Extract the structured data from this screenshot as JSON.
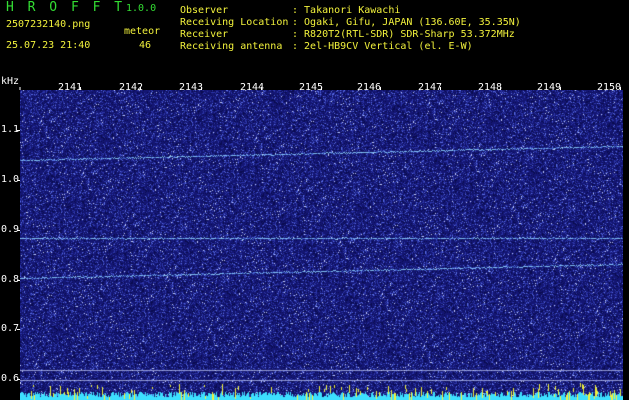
{
  "header": {
    "app_title": "H R O F F T",
    "version": "1.0.0",
    "file_name": "2507232140.png",
    "meteor_label": "meteor",
    "date_time": "25.07.23 21:40",
    "meteor_count": "46",
    "info": [
      {
        "key": "Observer",
        "value": ": Takanori Kawachi"
      },
      {
        "key": "Receiving Location",
        "value": ": Ogaki, Gifu, JAPAN (136.60E, 35.35N)"
      },
      {
        "key": "Receiver",
        "value": ": R820T2(RTL-SDR) SDR-Sharp 53.372MHz"
      },
      {
        "key": "Receiving antenna",
        "value": ": 2el-HB9CV Vertical (el. E-W)"
      }
    ]
  },
  "axes": {
    "y_unit": "kHz",
    "x_ticks": [
      "2141",
      "2142",
      "2143",
      "2144",
      "2145",
      "2146",
      "2147",
      "2148",
      "2149",
      "2150"
    ],
    "y_ticks": [
      "1.1",
      "1.0",
      "0.9",
      "0.8",
      "0.7",
      "0.6"
    ]
  },
  "colors": {
    "header_green": "#33dd33",
    "header_yellow": "#f2f23c",
    "waterfall_background": "#1a1a7a",
    "signal_trace": "#7fc8ff",
    "intensity_bar": "#3de0ff"
  }
}
